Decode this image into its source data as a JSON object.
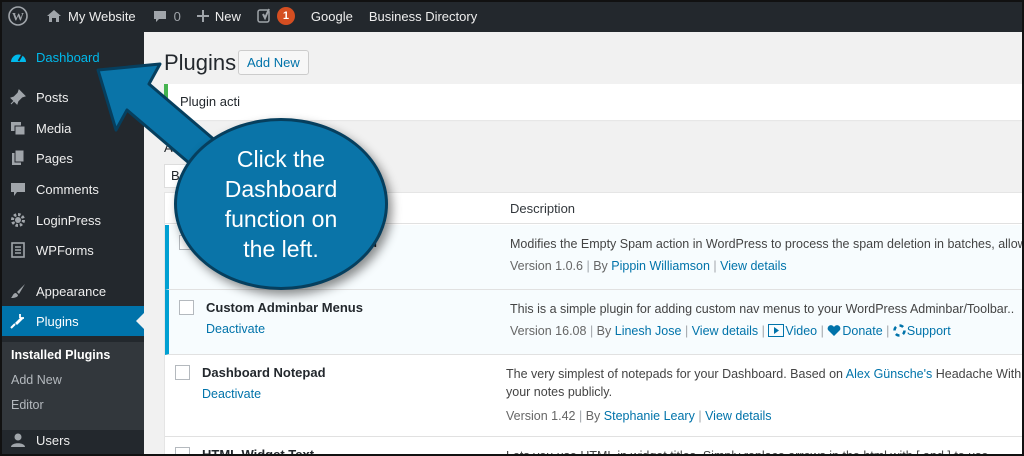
{
  "admin_bar": {
    "site_name": "My Website",
    "comments_count": "0",
    "new_label": "New",
    "yoast_badge": "1",
    "google_label": "Google",
    "business_label": "Business Directory"
  },
  "sidebar": {
    "items": [
      {
        "label": "Dashboard",
        "icon": "dashboard-icon"
      },
      {
        "label": "Posts",
        "icon": "pin-icon"
      },
      {
        "label": "Media",
        "icon": "media-icon"
      },
      {
        "label": "Pages",
        "icon": "pages-icon"
      },
      {
        "label": "Comments",
        "icon": "comment-icon"
      },
      {
        "label": "LoginPress",
        "icon": "gear-icon"
      },
      {
        "label": "WPForms",
        "icon": "forms-icon"
      },
      {
        "label": "Appearance",
        "icon": "brush-icon"
      },
      {
        "label": "Plugins",
        "icon": "plug-icon"
      },
      {
        "label": "Users",
        "icon": "user-icon"
      }
    ],
    "submenu": [
      "Installed Plugins",
      "Add New",
      "Editor"
    ]
  },
  "page": {
    "title": "Plugins",
    "add_new": "Add New",
    "notice": "Plugin acti",
    "filter_all": "All",
    "bulk_fragment": "B"
  },
  "table": {
    "header_description": "Description",
    "rows": [
      {
        "name": "n",
        "action": "",
        "description": "Modifies the Empty Spam action in WordPress to process the spam deletion in batches, allowing yo",
        "version": "Version 1.0.6",
        "by": "By",
        "author": "Pippin Williamson",
        "view": "View details"
      },
      {
        "name": "Custom Adminbar Menus",
        "action": "Deactivate",
        "description": "This is a simple plugin for adding custom nav menus to your WordPress Adminbar/Toolbar..",
        "version": "Version 16.08",
        "by": "By",
        "author": "Linesh Jose",
        "view": "View details",
        "extra": [
          "Video",
          "Donate",
          "Support"
        ]
      },
      {
        "name": "Dashboard Notepad",
        "action": "Deactivate",
        "description_pre": "The very simplest of notepads for your Dashboard. Based on ",
        "description_link": "Alex Günsche's",
        "description_post": " Headache With Pictures",
        "description_line2": "your notes publicly.",
        "version": "Version 1.42",
        "by": "By",
        "author": "Stephanie Leary",
        "view": "View details"
      },
      {
        "name": "HTML Widget Text",
        "description": "Lets you use HTML in widget titles. Simply replace arrows in the html with [ and ] to use."
      }
    ]
  },
  "callout": {
    "text": "Click the Dashboard function on the left.",
    "color": "#0a74a8"
  },
  "colors": {
    "admin_bar": "#23282d",
    "highlight": "#0073aa",
    "dashboard_link": "#00b9eb"
  }
}
